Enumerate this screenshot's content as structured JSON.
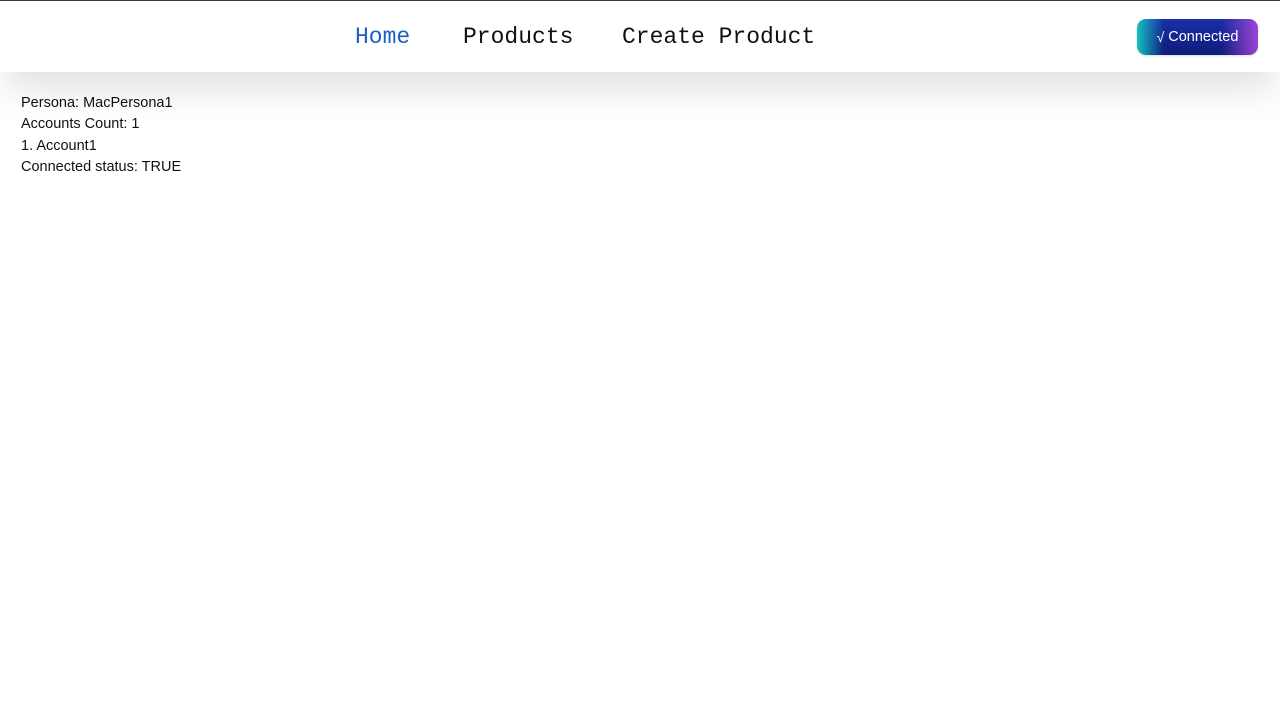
{
  "nav": {
    "links": [
      {
        "label": "Home",
        "active": true
      },
      {
        "label": "Products",
        "active": false
      },
      {
        "label": "Create Product",
        "active": false
      }
    ],
    "active_color": "#1f5fc4",
    "text_color": "#111111"
  },
  "wallet": {
    "button_label": "Connected",
    "icon": "check-icon",
    "icon_glyph": "√"
  },
  "info": {
    "persona": "Persona: MacPersona1",
    "accounts_count": "Accounts Count: 1",
    "accounts": [
      "1. Account1"
    ],
    "connected_status": "Connected status: TRUE"
  }
}
